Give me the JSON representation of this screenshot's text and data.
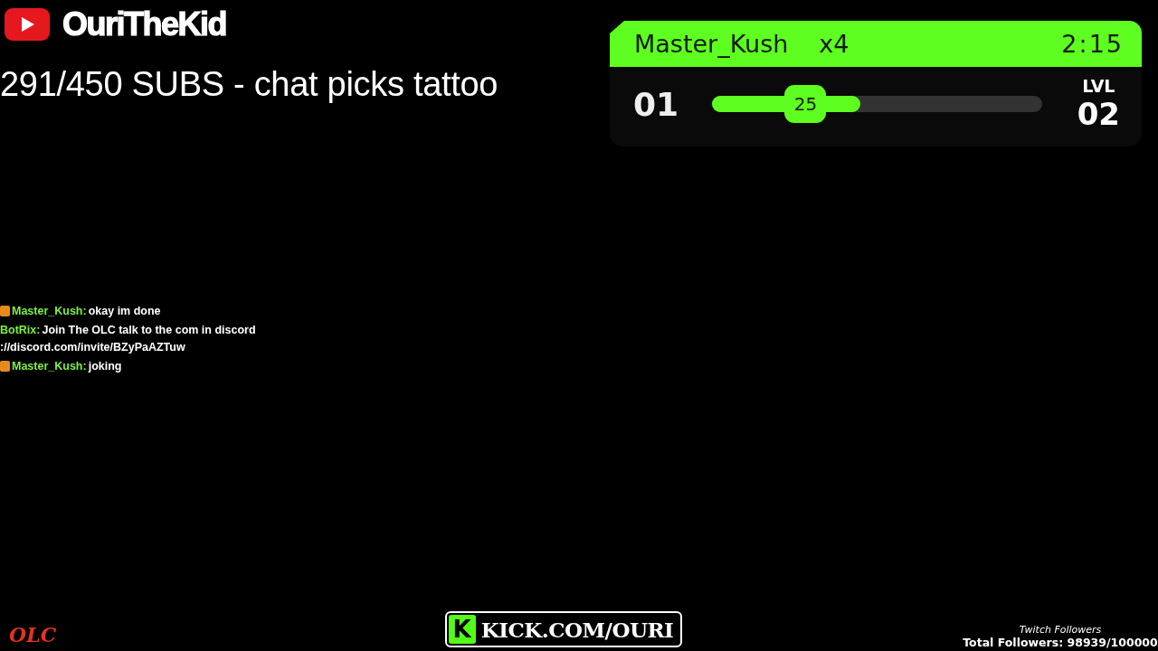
{
  "channel": {
    "name": "OuriTheKid"
  },
  "goal": {
    "text": "291/450 SUBS - chat picks tattoo"
  },
  "combo": {
    "user": "Master_Kush",
    "multiplier": "x4",
    "timer": "2:15",
    "count": "01",
    "progress": {
      "level": 0.45,
      "value": "25"
    },
    "level_label": "LVL",
    "level_value": "02"
  },
  "chat": [
    {
      "user": "Master_Kush:",
      "badge": true,
      "lines": [
        "okay im done"
      ]
    },
    {
      "user": "BotRix:",
      "badge": false,
      "lines": [
        "Join The OLC talk to the com in discord",
        "://discord.com/invite/BZyPaAZTuw"
      ]
    },
    {
      "user": "Master_Kush:",
      "badge": true,
      "lines": [
        "joking"
      ]
    }
  ],
  "footer": {
    "brand": "OLC",
    "kick": {
      "logo": "K",
      "url": "KICK.COM/OURI"
    },
    "followers": {
      "label": "Twitch Followers",
      "total": "Total Followers: 98939/100000"
    }
  }
}
